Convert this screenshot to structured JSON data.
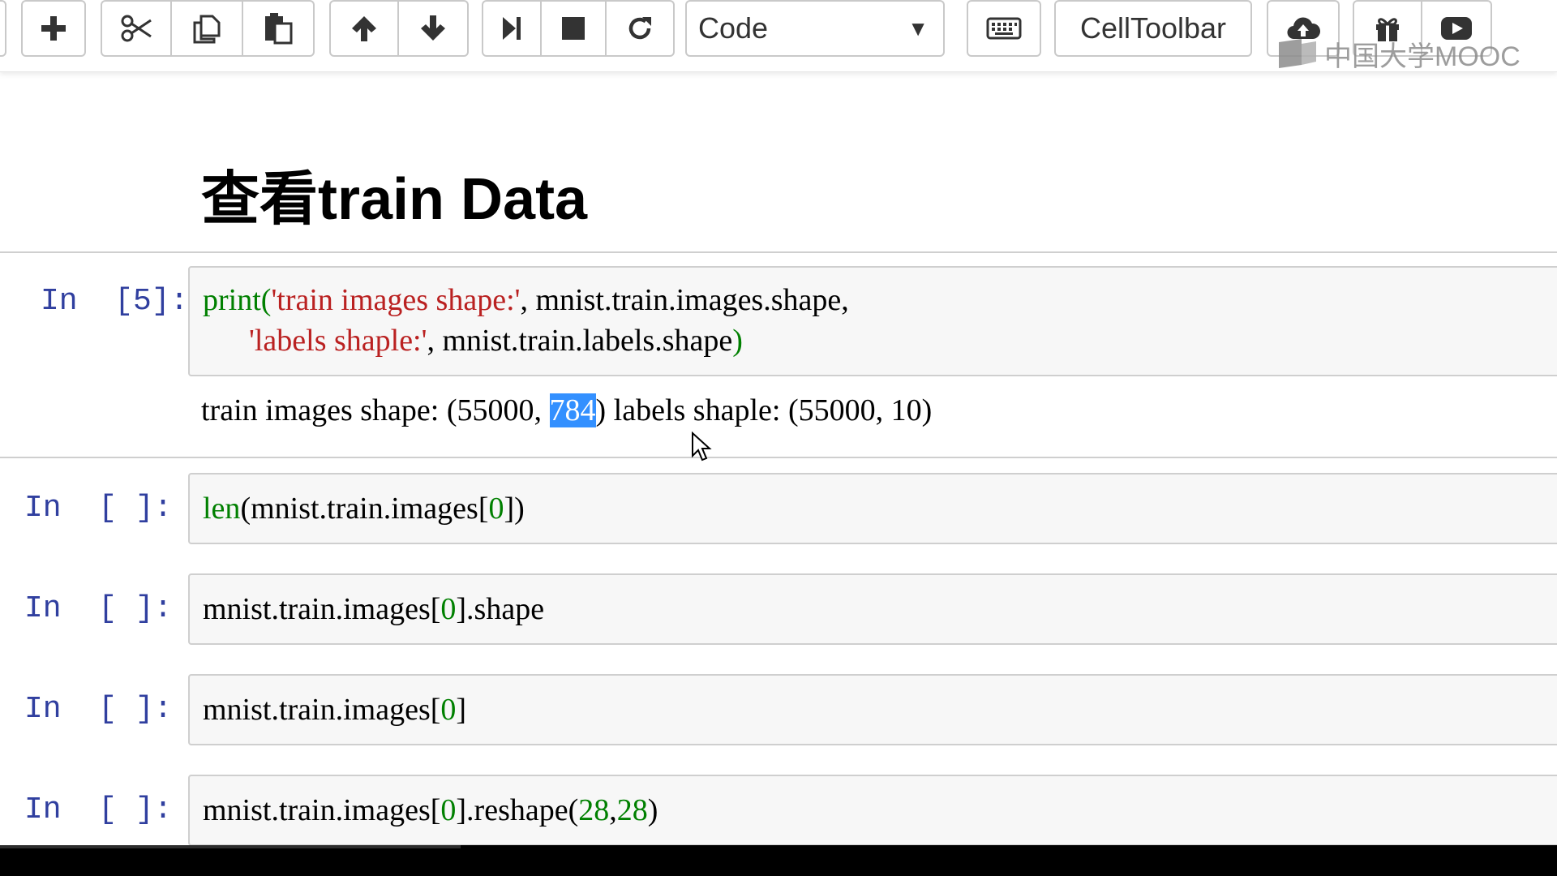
{
  "toolbar": {
    "buttons": [
      {
        "name": "insert-cell-button",
        "icon": "plus-icon"
      },
      {
        "name": "cut-button",
        "icon": "scissors-icon"
      },
      {
        "name": "copy-button",
        "icon": "copy-icon"
      },
      {
        "name": "paste-button",
        "icon": "paste-icon"
      },
      {
        "name": "move-up-button",
        "icon": "arrow-up-icon"
      },
      {
        "name": "move-down-button",
        "icon": "arrow-down-icon"
      },
      {
        "name": "run-button",
        "icon": "step-forward-icon"
      },
      {
        "name": "interrupt-button",
        "icon": "stop-icon"
      },
      {
        "name": "restart-button",
        "icon": "refresh-icon"
      },
      {
        "name": "keyboard-shortcuts-button",
        "icon": "keyboard-icon"
      },
      {
        "name": "upload-button",
        "icon": "cloud-upload-icon"
      },
      {
        "name": "gift-button",
        "icon": "gift-icon"
      },
      {
        "name": "youtube-button",
        "icon": "play-icon"
      }
    ],
    "cell_type_value": "Code",
    "cell_toolbar_label": "CellToolbar"
  },
  "watermark": {
    "text": "中国大学MOOC"
  },
  "heading": {
    "text": "查看train Data"
  },
  "cells": [
    {
      "prompt": "In  [5]:",
      "code_lines": [
        [
          {
            "t": "print",
            "c": "kw"
          },
          {
            "t": "(",
            "c": "kw"
          },
          {
            "t": "'train images shape:'",
            "c": "str"
          },
          {
            "t": ", mnist.train.images.shape,",
            "c": ""
          }
        ],
        [
          {
            "t": "      ",
            "c": ""
          },
          {
            "t": "'labels shaple:'",
            "c": "str"
          },
          {
            "t": ", mnist.train.labels.shape",
            "c": ""
          },
          {
            "t": ")",
            "c": "kw"
          }
        ]
      ],
      "output": {
        "before": "train images shape: (55000, ",
        "selected": "784",
        "after": ") labels shaple: (55000, 10)"
      }
    },
    {
      "prompt": "In  [ ]:",
      "code_lines": [
        [
          {
            "t": "len",
            "c": "kw"
          },
          {
            "t": "(mnist.train.images[",
            "c": ""
          },
          {
            "t": "0",
            "c": "num"
          },
          {
            "t": "])",
            "c": ""
          }
        ]
      ]
    },
    {
      "prompt": "In  [ ]:",
      "code_lines": [
        [
          {
            "t": "mnist.train.images[",
            "c": ""
          },
          {
            "t": "0",
            "c": "num"
          },
          {
            "t": "].shape",
            "c": ""
          }
        ]
      ]
    },
    {
      "prompt": "In  [ ]:",
      "code_lines": [
        [
          {
            "t": "mnist.train.images[",
            "c": ""
          },
          {
            "t": "0",
            "c": "num"
          },
          {
            "t": "]",
            "c": ""
          }
        ]
      ]
    },
    {
      "prompt": "In  [ ]:",
      "code_lines": [
        [
          {
            "t": "mnist.train.images[",
            "c": ""
          },
          {
            "t": "0",
            "c": "num"
          },
          {
            "t": "].reshape(",
            "c": ""
          },
          {
            "t": "28",
            "c": "num"
          },
          {
            "t": ",",
            "c": ""
          },
          {
            "t": "28",
            "c": "num"
          },
          {
            "t": ")",
            "c": ""
          }
        ]
      ]
    }
  ],
  "colors": {
    "prompt": "#303f9f",
    "keyword": "#008000",
    "string": "#ba2121",
    "selection": "#3390ff"
  }
}
